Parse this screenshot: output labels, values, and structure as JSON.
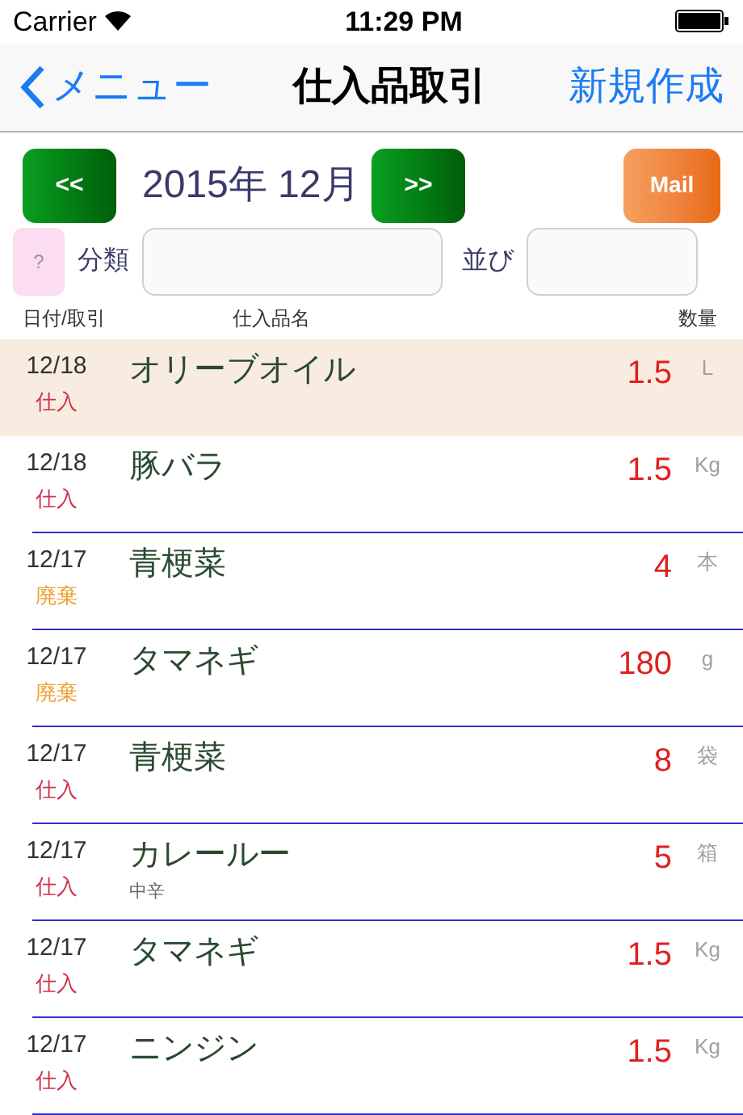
{
  "status_bar": {
    "carrier": "Carrier",
    "time": "11:29 PM"
  },
  "nav": {
    "back": "メニュー",
    "title": "仕入品取引",
    "action": "新規作成"
  },
  "month_bar": {
    "prev": "<<",
    "month": "2015年 12月",
    "next": ">>",
    "mail": "Mail"
  },
  "filters": {
    "help": "?",
    "category_label": "分類",
    "sort_label": "並び"
  },
  "columns": [
    "日付/取引",
    "仕入品名",
    "数量"
  ],
  "rows": [
    {
      "date": "12/18",
      "type": "仕入",
      "kind": "purchase",
      "name": "オリーブオイル",
      "qty": "1.5",
      "unit": "L",
      "selected": true
    },
    {
      "date": "12/18",
      "type": "仕入",
      "kind": "purchase",
      "name": "豚バラ",
      "qty": "1.5",
      "unit": "Kg",
      "selected": false
    },
    {
      "date": "12/17",
      "type": "廃棄",
      "kind": "disposal",
      "name": "青梗菜",
      "qty": "4",
      "unit": "本",
      "selected": false
    },
    {
      "date": "12/17",
      "type": "廃棄",
      "kind": "disposal",
      "name": "タマネギ",
      "qty": "180",
      "unit": "g",
      "selected": false
    },
    {
      "date": "12/17",
      "type": "仕入",
      "kind": "purchase",
      "name": "青梗菜",
      "qty": "8",
      "unit": "袋",
      "selected": false
    },
    {
      "date": "12/17",
      "type": "仕入",
      "kind": "purchase",
      "name": "カレールー",
      "note": "中辛",
      "qty": "5",
      "unit": "箱",
      "selected": false
    },
    {
      "date": "12/17",
      "type": "仕入",
      "kind": "purchase",
      "name": "タマネギ",
      "qty": "1.5",
      "unit": "Kg",
      "selected": false
    },
    {
      "date": "12/17",
      "type": "仕入",
      "kind": "purchase",
      "name": "ニンジン",
      "qty": "1.5",
      "unit": "Kg",
      "selected": false
    }
  ]
}
